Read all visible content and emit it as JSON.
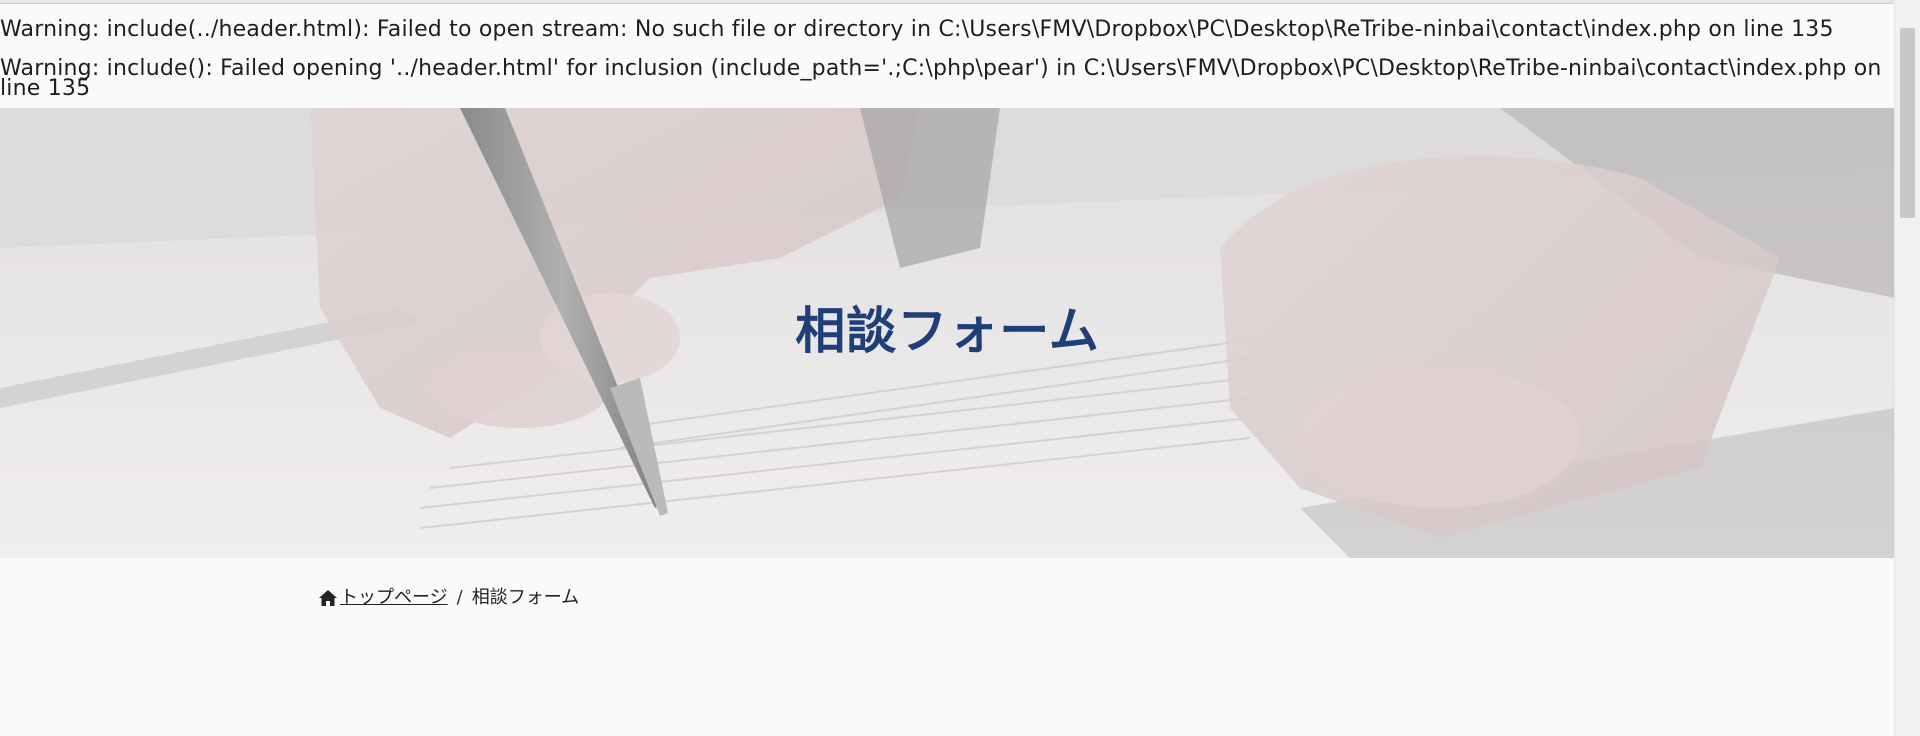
{
  "warnings": {
    "line1": "Warning: include(../header.html): Failed to open stream: No such file or directory in C:\\Users\\FMV\\Dropbox\\PC\\Desktop\\ReTribe-ninbai\\contact\\index.php on line 135",
    "line2": "Warning: include(): Failed opening '../header.html' for inclusion (include_path='.;C:\\php\\pear') in C:\\Users\\FMV\\Dropbox\\PC\\Desktop\\ReTribe-ninbai\\contact\\index.php on line 135"
  },
  "hero": {
    "title": "相談フォーム",
    "image_name": "hand-writing-contract-image"
  },
  "breadcrumb": {
    "home_icon": "home-icon",
    "home_label": "トップページ",
    "separator": "/",
    "current": "相談フォーム"
  },
  "colors": {
    "title": "#1f3f78",
    "title_underline": "#efc659",
    "page_bg": "#fafafa"
  }
}
